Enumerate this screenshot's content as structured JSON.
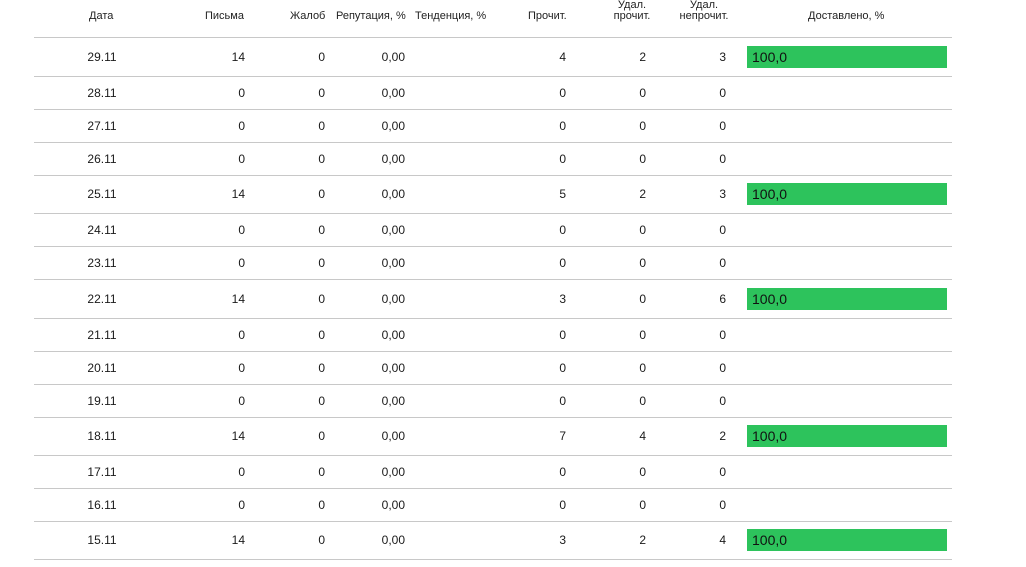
{
  "colors": {
    "delivered_bar": "#2dc35c",
    "row_divider": "#c8c8c8"
  },
  "headers": {
    "date": "Дата",
    "letters": "Письма",
    "complaints": "Жалоб",
    "reputation": "Репутация, %",
    "trend": "Тенденция, %",
    "read": "Прочит.",
    "deleted_read_1": "Удал.",
    "deleted_read_2": "прочит.",
    "deleted_unread_1": "Удал.",
    "deleted_unread_2": "непрочит.",
    "delivered": "Доставлено, %"
  },
  "rows": [
    {
      "date": "29.11",
      "letters": "14",
      "complaints": "0",
      "reputation": "0,00",
      "read": "4",
      "deleted_read": "2",
      "deleted_unread": "3",
      "delivered": "100,0"
    },
    {
      "date": "28.11",
      "letters": "0",
      "complaints": "0",
      "reputation": "0,00",
      "read": "0",
      "deleted_read": "0",
      "deleted_unread": "0",
      "delivered": ""
    },
    {
      "date": "27.11",
      "letters": "0",
      "complaints": "0",
      "reputation": "0,00",
      "read": "0",
      "deleted_read": "0",
      "deleted_unread": "0",
      "delivered": ""
    },
    {
      "date": "26.11",
      "letters": "0",
      "complaints": "0",
      "reputation": "0,00",
      "read": "0",
      "deleted_read": "0",
      "deleted_unread": "0",
      "delivered": ""
    },
    {
      "date": "25.11",
      "letters": "14",
      "complaints": "0",
      "reputation": "0,00",
      "read": "5",
      "deleted_read": "2",
      "deleted_unread": "3",
      "delivered": "100,0"
    },
    {
      "date": "24.11",
      "letters": "0",
      "complaints": "0",
      "reputation": "0,00",
      "read": "0",
      "deleted_read": "0",
      "deleted_unread": "0",
      "delivered": ""
    },
    {
      "date": "23.11",
      "letters": "0",
      "complaints": "0",
      "reputation": "0,00",
      "read": "0",
      "deleted_read": "0",
      "deleted_unread": "0",
      "delivered": ""
    },
    {
      "date": "22.11",
      "letters": "14",
      "complaints": "0",
      "reputation": "0,00",
      "read": "3",
      "deleted_read": "0",
      "deleted_unread": "6",
      "delivered": "100,0"
    },
    {
      "date": "21.11",
      "letters": "0",
      "complaints": "0",
      "reputation": "0,00",
      "read": "0",
      "deleted_read": "0",
      "deleted_unread": "0",
      "delivered": ""
    },
    {
      "date": "20.11",
      "letters": "0",
      "complaints": "0",
      "reputation": "0,00",
      "read": "0",
      "deleted_read": "0",
      "deleted_unread": "0",
      "delivered": ""
    },
    {
      "date": "19.11",
      "letters": "0",
      "complaints": "0",
      "reputation": "0,00",
      "read": "0",
      "deleted_read": "0",
      "deleted_unread": "0",
      "delivered": ""
    },
    {
      "date": "18.11",
      "letters": "14",
      "complaints": "0",
      "reputation": "0,00",
      "read": "7",
      "deleted_read": "4",
      "deleted_unread": "2",
      "delivered": "100,0"
    },
    {
      "date": "17.11",
      "letters": "0",
      "complaints": "0",
      "reputation": "0,00",
      "read": "0",
      "deleted_read": "0",
      "deleted_unread": "0",
      "delivered": ""
    },
    {
      "date": "16.11",
      "letters": "0",
      "complaints": "0",
      "reputation": "0,00",
      "read": "0",
      "deleted_read": "0",
      "deleted_unread": "0",
      "delivered": ""
    },
    {
      "date": "15.11",
      "letters": "14",
      "complaints": "0",
      "reputation": "0,00",
      "read": "3",
      "deleted_read": "2",
      "deleted_unread": "4",
      "delivered": "100,0"
    }
  ]
}
